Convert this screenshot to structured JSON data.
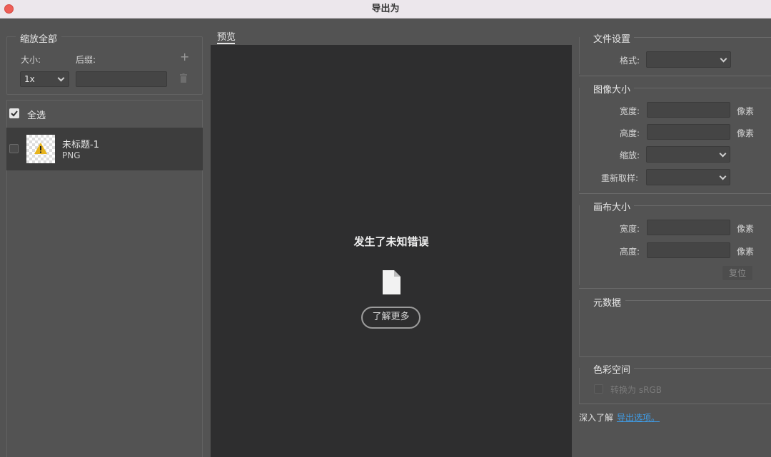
{
  "window": {
    "title": "导出为"
  },
  "left": {
    "scale_all": "缩放全部",
    "size_label": "大小:",
    "suffix_label": "后缀:",
    "size_value": "1x",
    "suffix_value": "",
    "add_icon": "plus-icon",
    "delete_icon": "trash-icon",
    "select_all": "全选",
    "assets": [
      {
        "name": "未标题-1",
        "format": "PNG",
        "checked": false
      }
    ]
  },
  "preview": {
    "tab_label": "预览",
    "error_title": "发生了未知错误",
    "file_icon": "file-icon",
    "learn_more": "了解更多"
  },
  "right": {
    "file_settings": {
      "heading": "文件设置",
      "format_label": "格式:",
      "format_value": ""
    },
    "image_size": {
      "heading": "图像大小",
      "width_label": "宽度:",
      "width_value": "",
      "height_label": "高度:",
      "height_value": "",
      "unit": "像素",
      "scale_label": "缩放:",
      "scale_value": "",
      "resample_label": "重新取样:",
      "resample_value": ""
    },
    "canvas_size": {
      "heading": "画布大小",
      "width_label": "宽度:",
      "width_value": "",
      "height_label": "高度:",
      "height_value": "",
      "unit": "像素",
      "reset": "复位"
    },
    "metadata": {
      "heading": "元数据"
    },
    "color_space": {
      "heading": "色彩空间",
      "convert_label": "转换为 sRGB"
    },
    "footer": {
      "learn_more_prefix": "深入了解",
      "export_options_link": "导出选项。"
    }
  },
  "colors": {
    "panel_bg": "#535353",
    "preview_bg": "#2e2e2f",
    "link": "#3f9ce6",
    "warning": "#e8b41c"
  }
}
